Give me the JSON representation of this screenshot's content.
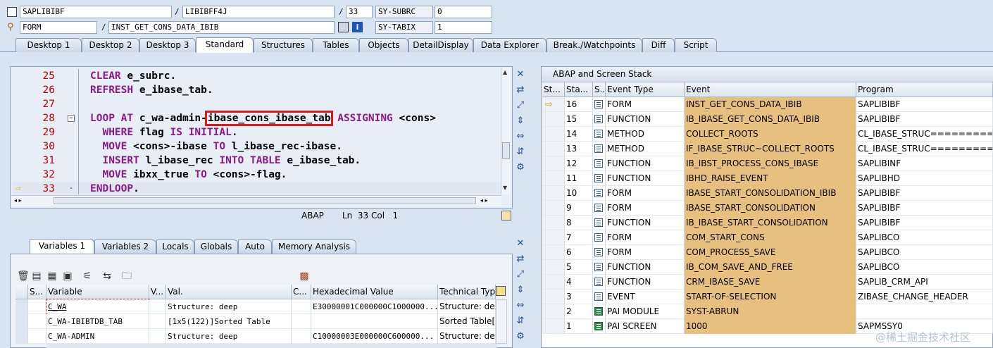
{
  "header": {
    "program": "SAPLIBIBF",
    "include": "LIBIBFF4J",
    "line": "33",
    "sy_subrc_label": "SY-SUBRC",
    "sy_subrc_value": "0",
    "kind": "FORM",
    "event_name": "INST_GET_CONS_DATA_IBIB",
    "sy_tabix_label": "SY-TABIX",
    "sy_tabix_value": "1"
  },
  "tabs": [
    "Desktop 1",
    "Desktop 2",
    "Desktop 3",
    "Standard",
    "Structures",
    "Tables",
    "Objects",
    "DetailDisplay",
    "Data Explorer",
    "Break./Watchpoints",
    "Diff",
    "Script"
  ],
  "active_tab": "Standard",
  "code": {
    "lines": [
      {
        "n": "25",
        "parts": [
          {
            "t": "CLEAR",
            "k": 1
          },
          {
            "t": " e_subrc.",
            "k": 0
          }
        ]
      },
      {
        "n": "26",
        "parts": [
          {
            "t": "REFRESH",
            "k": 1
          },
          {
            "t": " e_ibase_tab.",
            "k": 0
          }
        ]
      },
      {
        "n": "27",
        "parts": []
      },
      {
        "n": "28",
        "parts": [
          {
            "t": "LOOP AT",
            "k": 1
          },
          {
            "t": " c_wa-admin-",
            "k": 0
          },
          {
            "t": "ibase_cons_ibase_tab",
            "k": 0
          },
          {
            "t": " ASSIGNING",
            "k": 1
          },
          {
            "t": " <cons>",
            "k": 0
          }
        ]
      },
      {
        "n": "29",
        "parts": [
          {
            "t": "  WHERE",
            "k": 1
          },
          {
            "t": " flag ",
            "k": 0
          },
          {
            "t": "IS INITIAL",
            "k": 1
          },
          {
            "t": ".",
            "k": 0
          }
        ]
      },
      {
        "n": "30",
        "parts": [
          {
            "t": "  MOVE",
            "k": 1
          },
          {
            "t": " <cons>-ibase ",
            "k": 0
          },
          {
            "t": "TO",
            "k": 1
          },
          {
            "t": " l_ibase_rec-ibase.",
            "k": 0
          }
        ]
      },
      {
        "n": "31",
        "parts": [
          {
            "t": "  INSERT",
            "k": 1
          },
          {
            "t": " l_ibase_rec ",
            "k": 0
          },
          {
            "t": "INTO TABLE",
            "k": 1
          },
          {
            "t": " e_ibase_tab.",
            "k": 0
          }
        ]
      },
      {
        "n": "32",
        "parts": [
          {
            "t": "  MOVE",
            "k": 1
          },
          {
            "t": " ibxx_true ",
            "k": 0
          },
          {
            "t": "TO",
            "k": 1
          },
          {
            "t": " <cons>-flag.",
            "k": 0
          }
        ]
      },
      {
        "n": "33",
        "parts": [
          {
            "t": "ENDLOOP",
            "k": 1
          },
          {
            "t": ".",
            "k": 0
          }
        ]
      }
    ],
    "status_lang": "ABAP",
    "status_pos": "Ln  33 Col   1"
  },
  "var_tabs": [
    "Variables 1",
    "Variables 2",
    "Locals",
    "Globals",
    "Auto",
    "Memory Analysis"
  ],
  "var_cols": [
    "S...",
    "Variable",
    "V...",
    "Val.",
    "C...",
    "Hexadecimal Value",
    "Technical Typ"
  ],
  "var_rows": [
    {
      "var": "C_WA",
      "val": "Structure: deep",
      "hex": "E30000001C000000C1000000...",
      "type": "Structure: dee"
    },
    {
      "var": "C_WA-IBIBTDB_TAB",
      "val": "[1x5(122)]Sorted Table",
      "hex": "",
      "type": "Sorted Table["
    },
    {
      "var": "C_WA-ADMIN",
      "val": "Structure: deep",
      "hex": "C10000003E000000C600000...",
      "type": "Structure: dee"
    }
  ],
  "stack": {
    "title": "ABAP and Screen Stack",
    "cols": [
      "St...",
      "Sta...",
      "S...",
      "Event Type",
      "Event",
      "Program"
    ],
    "rows": [
      {
        "cur": true,
        "n": "16",
        "type": "FORM",
        "event": "INST_GET_CONS_DATA_IBIB",
        "prog": "SAPLIBIBF"
      },
      {
        "n": "15",
        "type": "FUNCTION",
        "event": "IB_IBASE_GET_CONS_DATA_IBIB",
        "prog": "SAPLIBIBF"
      },
      {
        "n": "14",
        "type": "METHOD",
        "event": "COLLECT_ROOTS",
        "prog": "CL_IBASE_STRUC============="
      },
      {
        "n": "13",
        "type": "METHOD",
        "event": "IF_IBASE_STRUC~COLLECT_ROOTS",
        "prog": "CL_IBASE_STRUC============="
      },
      {
        "n": "12",
        "type": "FUNCTION",
        "event": "IB_IBST_PROCESS_CONS_IBASE",
        "prog": "SAPLIBINF"
      },
      {
        "n": "11",
        "type": "FUNCTION",
        "event": "IBHD_RAISE_EVENT",
        "prog": "SAPLIBHD"
      },
      {
        "n": "10",
        "type": "FORM",
        "event": "IBASE_START_CONSOLIDATION_IBIB",
        "prog": "SAPLIBIBF"
      },
      {
        "n": "9",
        "type": "FORM",
        "event": "IBASE_START_CONSOLIDATION",
        "prog": "SAPLIBIBF"
      },
      {
        "n": "8",
        "type": "FUNCTION",
        "event": "IB_IBASE_START_CONSOLIDATION",
        "prog": "SAPLIBIBF"
      },
      {
        "n": "7",
        "type": "FORM",
        "event": "COM_START_CONS",
        "prog": "SAPLIBCO"
      },
      {
        "n": "6",
        "type": "FORM",
        "event": "COM_PROCESS_SAVE",
        "prog": "SAPLIBCO"
      },
      {
        "n": "5",
        "type": "FUNCTION",
        "event": "IB_COM_SAVE_AND_FREE",
        "prog": "SAPLIBCO"
      },
      {
        "n": "4",
        "type": "FUNCTION",
        "event": "CRM_IBASE_SAVE",
        "prog": "SAPLIB_CRM_API"
      },
      {
        "n": "3",
        "type": "EVENT",
        "event": "START-OF-SELECTION",
        "prog": "ZIBASE_CHANGE_HEADER"
      },
      {
        "n": "2",
        "type": "PAI MODULE",
        "event": "SYST-ABRUN",
        "prog": "",
        "green": true
      },
      {
        "n": "1",
        "type": "PAI SCREEN",
        "event": "1000",
        "prog": "SAPMSSY0",
        "green": true
      }
    ]
  },
  "watermark": "@稀土掘金技术社区",
  "colors": {
    "event_bg": "#e7c07f",
    "highlight_box": "#e01818",
    "line_numbers": "#c00000",
    "keywords": "#8a1a8a"
  }
}
